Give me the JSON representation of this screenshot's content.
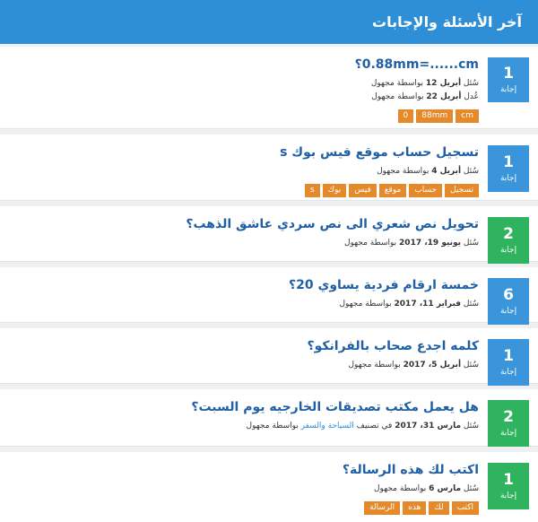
{
  "header": {
    "title": "آخر الأسئلة والإجابات"
  },
  "answer_label": "إجابة",
  "questions": [
    {
      "title": "0.88mm=......cm؟",
      "answers": "1",
      "color": "#3a95db",
      "meta": [
        {
          "prefix": "سُئل ",
          "date": "أبريل 12",
          "suffix": " بواسطة مجهول"
        },
        {
          "prefix": "عُدل ",
          "date": "أبريل 22",
          "suffix": " بواسطة مجهول"
        }
      ],
      "tags": [
        "cm",
        "88mm",
        "0"
      ]
    },
    {
      "title": "تسجيل حساب موقع فيس بوك s",
      "answers": "1",
      "color": "#3a95db",
      "meta": [
        {
          "prefix": "سُئل ",
          "date": "أبريل 4",
          "suffix": " بواسطة مجهول"
        }
      ],
      "tags": [
        "تسجيل",
        "حساب",
        "موقع",
        "فيس",
        "بوك",
        "s"
      ]
    },
    {
      "title": "تحويل نص شعري الى نص سردي عاشق الذهب؟",
      "answers": "2",
      "color": "#2fb35f",
      "meta": [
        {
          "prefix": "سُئل ",
          "date": "يونيو 19، 2017",
          "suffix": " بواسطة مجهول"
        }
      ],
      "tags": []
    },
    {
      "title": "خمسة ارقام فردية يساوي 20؟",
      "answers": "6",
      "color": "#3a95db",
      "meta": [
        {
          "prefix": "سُئل ",
          "date": "فبراير 11، 2017",
          "suffix": " بواسطة مجهول"
        }
      ],
      "tags": []
    },
    {
      "title": "كلمه اجدع صحاب بالفرانكو؟",
      "answers": "1",
      "color": "#3a95db",
      "meta": [
        {
          "prefix": "سُئل ",
          "date": "أبريل 5، 2017",
          "suffix": " بواسطة مجهول"
        }
      ],
      "tags": []
    },
    {
      "title": "هل يعمل مكتب تصديقات الخارجيه يوم السبت؟",
      "answers": "2",
      "color": "#2fb35f",
      "meta": [
        {
          "prefix": "سُئل ",
          "date": "مارس 31، 2017",
          "mid": " في تصنيف ",
          "category": "السياحة والسفر",
          "suffix": " بواسطة مجهول"
        }
      ],
      "tags": []
    },
    {
      "title": "اكتب لك هذه الرسالة؟",
      "answers": "1",
      "color": "#2fb35f",
      "meta": [
        {
          "prefix": "سُئل ",
          "date": "مارس 6",
          "suffix": " بواسطة مجهول"
        }
      ],
      "tags": [
        "اكتب",
        "لك",
        "هذه",
        "الرسالة"
      ]
    }
  ]
}
